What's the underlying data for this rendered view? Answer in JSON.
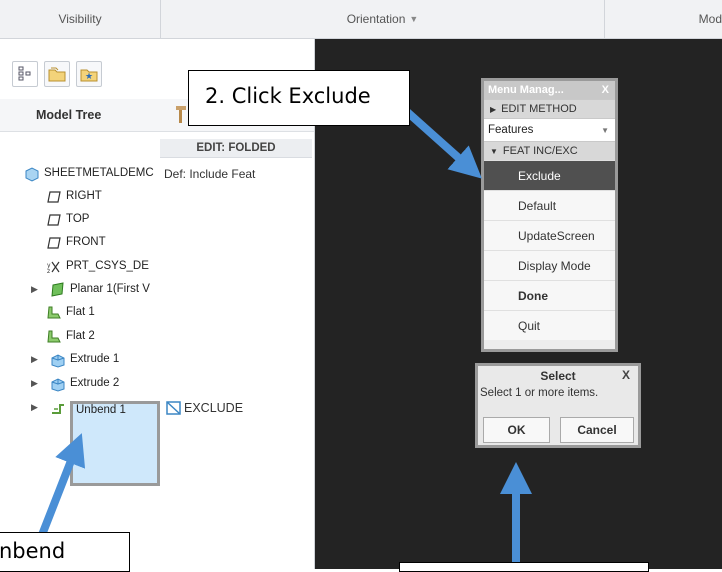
{
  "ribbon": {
    "visibility": "Visibility",
    "orientation": "Orientation",
    "model": "Mod"
  },
  "model_tree": {
    "title": "Model Tree",
    "column_header": "EDIT: FOLDED",
    "rows": [
      {
        "label": "SHEETMETALDEMC",
        "value": "Def: Include Feat",
        "icon": "part-icon"
      },
      {
        "label": "RIGHT",
        "icon": "datum-plane-icon"
      },
      {
        "label": "TOP",
        "icon": "datum-plane-icon"
      },
      {
        "label": "FRONT",
        "icon": "datum-plane-icon"
      },
      {
        "label": "PRT_CSYS_DE",
        "icon": "csys-icon"
      },
      {
        "label": "Planar 1(First V",
        "icon": "planar-wall-icon"
      },
      {
        "label": "Flat 1",
        "icon": "flat-wall-icon"
      },
      {
        "label": "Flat 2",
        "icon": "flat-wall-icon"
      },
      {
        "label": "Extrude 1",
        "icon": "extrude-icon"
      },
      {
        "label": "Extrude 2",
        "icon": "extrude-icon"
      },
      {
        "label": "Unbend 1",
        "value": "EXCLUDE",
        "icon": "unbend-icon"
      }
    ]
  },
  "menu_manager": {
    "title": "Menu Manag...",
    "close": "X",
    "edit_method": "EDIT METHOD",
    "features": "Features",
    "feat_inc_exc": "FEAT INC/EXC",
    "items": [
      "Exclude",
      "Default",
      "UpdateScreen",
      "Display Mode",
      "Done",
      "Quit"
    ]
  },
  "select_dialog": {
    "title": "Select",
    "close": "X",
    "message": "Select 1 or more items.",
    "ok": "OK",
    "cancel": "Cancel"
  },
  "annotations": {
    "callout_2": "2. Click Exclude",
    "callout_1_partial": "nbend"
  },
  "colors": {
    "viewport_bg": "#232323",
    "arrow": "#4a8fd6",
    "selection": "#cfe8fb",
    "menu_active": "#505050"
  }
}
